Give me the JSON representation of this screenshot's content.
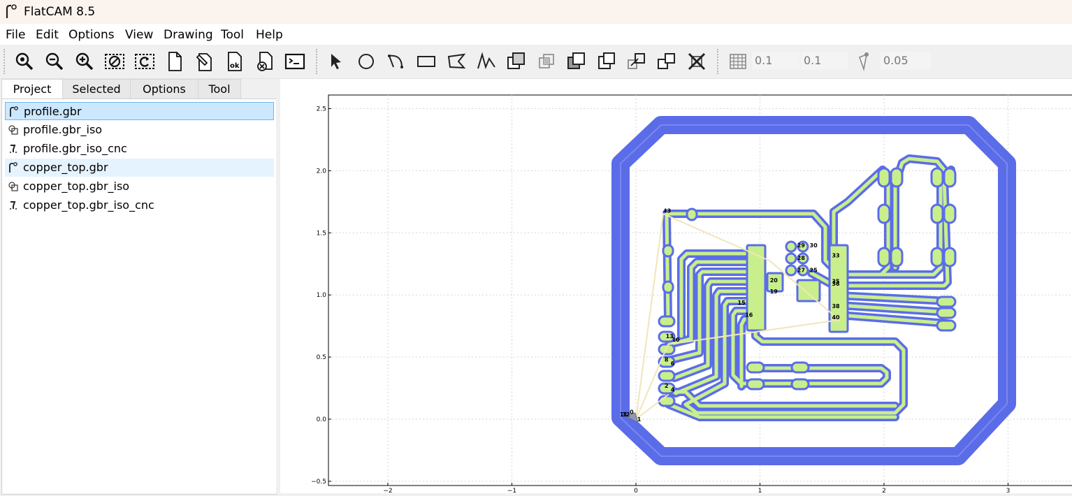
{
  "window": {
    "title": "FlatCAM 8.5",
    "icon": "flatcam-icon"
  },
  "menu": [
    "File",
    "Edit",
    "Options",
    "View",
    "Drawing",
    "Tool",
    "Help"
  ],
  "toolbar": {
    "view_tools": [
      "zoom-fit-icon",
      "zoom-out-icon",
      "zoom-in-icon",
      "clear-plot-icon",
      "replot-icon",
      "new-project-icon",
      "edit-icon",
      "ok-icon",
      "delete-icon",
      "shell-icon"
    ],
    "draw_tools": [
      "select-icon",
      "circle-icon",
      "arc-icon",
      "rectangle-icon",
      "polygon-icon",
      "path-icon",
      "union-icon",
      "intersection-icon",
      "subtract-icon",
      "cut-icon",
      "move-icon",
      "copy-icon",
      "delete-shape-icon"
    ],
    "grid_x": "0.1",
    "grid_y": "0.1",
    "snap_max": "0.05"
  },
  "tabs": [
    "Project",
    "Selected",
    "Options",
    "Tool"
  ],
  "active_tab": "Project",
  "project_items": [
    {
      "label": "profile.gbr",
      "icon": "gerber-icon",
      "state": "selected"
    },
    {
      "label": "profile.gbr_iso",
      "icon": "geometry-icon",
      "state": ""
    },
    {
      "label": "profile.gbr_iso_cnc",
      "icon": "cnc-icon",
      "state": ""
    },
    {
      "label": "copper_top.gbr",
      "icon": "gerber-icon",
      "state": "hover"
    },
    {
      "label": "copper_top.gbr_iso",
      "icon": "geometry-icon",
      "state": ""
    },
    {
      "label": "copper_top.gbr_iso_cnc",
      "icon": "cnc-icon",
      "state": ""
    }
  ],
  "plot": {
    "x_ticks": [
      "−2",
      "−1",
      "0",
      "1",
      "2",
      "3"
    ],
    "y_ticks": [
      "2.5",
      "2.0",
      "1.5",
      "1.0",
      "0.5",
      "0.0",
      "−0.5"
    ],
    "labels": [
      {
        "t": "43",
        "x": 0.22,
        "y": 1.68
      },
      {
        "t": "29",
        "x": 1.3,
        "y": 1.4
      },
      {
        "t": "30",
        "x": 1.4,
        "y": 1.4
      },
      {
        "t": "28",
        "x": 1.3,
        "y": 1.3
      },
      {
        "t": "27",
        "x": 1.3,
        "y": 1.2
      },
      {
        "t": "25",
        "x": 1.4,
        "y": 1.2
      },
      {
        "t": "33",
        "x": 1.58,
        "y": 1.32
      },
      {
        "t": "35",
        "x": 1.58,
        "y": 1.11
      },
      {
        "t": "36",
        "x": 1.58,
        "y": 1.09
      },
      {
        "t": "20",
        "x": 1.08,
        "y": 1.12
      },
      {
        "t": "19",
        "x": 1.08,
        "y": 1.03
      },
      {
        "t": "15",
        "x": 0.82,
        "y": 0.94
      },
      {
        "t": "16",
        "x": 0.88,
        "y": 0.84
      },
      {
        "t": "38",
        "x": 1.58,
        "y": 0.91
      },
      {
        "t": "40",
        "x": 1.58,
        "y": 0.82
      },
      {
        "t": "13",
        "x": 0.24,
        "y": 0.67
      },
      {
        "t": "10",
        "x": 0.29,
        "y": 0.64
      },
      {
        "t": "8",
        "x": 0.23,
        "y": 0.48
      },
      {
        "t": "6",
        "x": 0.28,
        "y": 0.45
      },
      {
        "t": "2",
        "x": 0.23,
        "y": 0.27
      },
      {
        "t": "4",
        "x": 0.28,
        "y": 0.24
      },
      {
        "t": "11",
        "x": -0.13,
        "y": 0.04
      },
      {
        "t": "12",
        "x": -0.11,
        "y": 0.04
      },
      {
        "t": "0",
        "x": -0.05,
        "y": 0.06
      },
      {
        "t": "1",
        "x": 0.01,
        "y": 0.0
      }
    ],
    "colors": {
      "outline": "#5b6ce8",
      "fill": "#c9ef8c",
      "travel": "#f0e6b8",
      "grid": "#d6d6d6"
    }
  }
}
